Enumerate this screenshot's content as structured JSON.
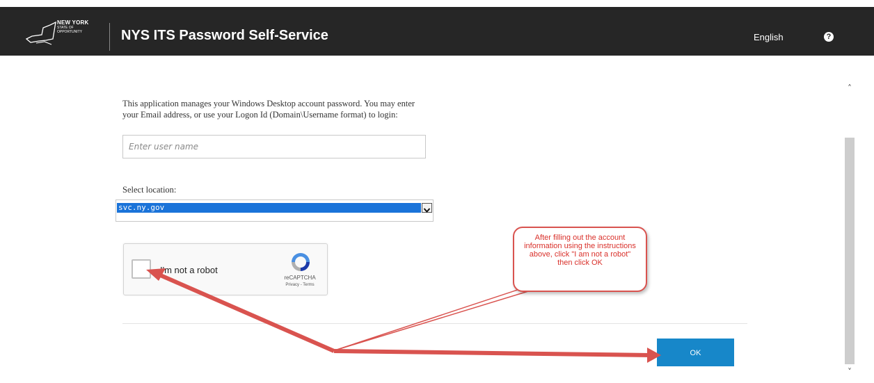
{
  "header": {
    "logo": {
      "line1": "NEW YORK",
      "line2": "STATE OF",
      "line3": "OPPORTUNITY"
    },
    "title": "NYS ITS Password Self-Service",
    "language": "English",
    "help_icon": "question-circle-icon"
  },
  "form": {
    "intro": "This application manages your Windows Desktop account password. You may enter your Email address, or use your Logon Id (Domain\\Username format) to login:",
    "username_placeholder": "Enter user name",
    "location_label": "Select location:",
    "location_selected": "svc.ny.gov",
    "captcha": {
      "label": "I'm not a robot",
      "brand": "reCAPTCHA",
      "links": "Privacy - Terms"
    },
    "ok_label": "OK"
  },
  "annotation": {
    "callout_text": "After filling out the account information using the instructions above, click \"I am not a robot\" then click OK",
    "color": "#d9534f"
  },
  "scrollbar": {
    "up_icon": "chevron-up-icon",
    "down_icon": "chevron-down-icon"
  },
  "colors": {
    "header_bg": "#262626",
    "select_highlight": "#1a73d9",
    "ok_button": "#1787c9"
  }
}
